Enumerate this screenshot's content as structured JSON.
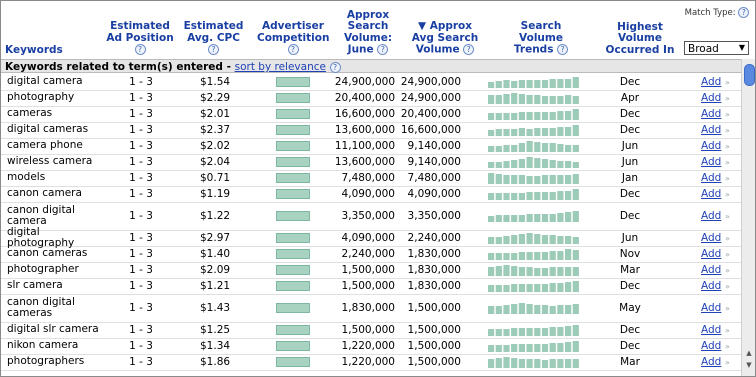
{
  "header": {
    "keywords": "Keywords",
    "est_pos": [
      "Estimated",
      "Ad Position"
    ],
    "est_cpc": [
      "Estimated",
      "Avg. CPC"
    ],
    "competition": [
      "Advertiser",
      "Competition"
    ],
    "june_vol": [
      "Approx",
      "Search",
      "Volume:",
      "June"
    ],
    "avg_vol": [
      "▼ Approx",
      "Avg Search",
      "Volume"
    ],
    "trends": [
      "Search Volume",
      "Trends"
    ],
    "highest": [
      "Highest",
      "Volume",
      "Occurred In"
    ],
    "match_type_label": "Match Type:",
    "match_type_value": "Broad",
    "help_glyph": "?"
  },
  "subheader": {
    "label": "Keywords related to term(s) entered - ",
    "sort_link": "sort by relevance"
  },
  "colors": {
    "header_blue": "#1a3fa3",
    "link": "#1f41b5",
    "bar": "#a8d3c1",
    "trend_bar": "#9ccbb7"
  },
  "rows": [
    {
      "keyword": "digital camera",
      "pos": "1 - 3",
      "cpc": "$1.54",
      "competition": 1.0,
      "june": "24,900,000",
      "avg": "24,900,000",
      "month": "Dec",
      "add": "Add",
      "trend": [
        0.55,
        0.6,
        0.7,
        0.65,
        0.7,
        0.75,
        0.7,
        0.72,
        0.78,
        0.8,
        0.85,
        1.0
      ]
    },
    {
      "keyword": "photography",
      "pos": "1 - 3",
      "cpc": "$2.29",
      "competition": 1.0,
      "june": "20,400,000",
      "avg": "24,900,000",
      "month": "Apr",
      "add": "Add",
      "trend": [
        0.8,
        0.85,
        0.9,
        1.0,
        0.9,
        0.85,
        0.8,
        0.75,
        0.7,
        0.75,
        0.8,
        0.7
      ]
    },
    {
      "keyword": "cameras",
      "pos": "1 - 3",
      "cpc": "$2.01",
      "competition": 1.0,
      "june": "16,600,000",
      "avg": "20,400,000",
      "month": "Dec",
      "add": "Add",
      "trend": [
        0.6,
        0.6,
        0.65,
        0.65,
        0.7,
        0.7,
        0.72,
        0.7,
        0.75,
        0.8,
        0.85,
        1.0
      ]
    },
    {
      "keyword": "digital cameras",
      "pos": "1 - 3",
      "cpc": "$2.37",
      "competition": 1.0,
      "june": "13,600,000",
      "avg": "16,600,000",
      "month": "Dec",
      "add": "Add",
      "trend": [
        0.55,
        0.6,
        0.65,
        0.6,
        0.7,
        0.65,
        0.7,
        0.72,
        0.75,
        0.8,
        0.85,
        1.0
      ]
    },
    {
      "keyword": "camera phone",
      "pos": "1 - 3",
      "cpc": "$2.02",
      "competition": 1.0,
      "june": "11,100,000",
      "avg": "9,140,000",
      "month": "Jun",
      "add": "Add",
      "trend": [
        0.5,
        0.55,
        0.6,
        0.65,
        0.8,
        1.0,
        0.9,
        0.85,
        0.8,
        0.7,
        0.65,
        0.6
      ]
    },
    {
      "keyword": "wireless camera",
      "pos": "1 - 3",
      "cpc": "$2.04",
      "competition": 1.0,
      "june": "13,600,000",
      "avg": "9,140,000",
      "month": "Jun",
      "add": "Add",
      "trend": [
        0.5,
        0.55,
        0.6,
        0.7,
        0.8,
        1.0,
        0.9,
        0.8,
        0.7,
        0.65,
        0.6,
        0.55
      ]
    },
    {
      "keyword": "models",
      "pos": "1 - 3",
      "cpc": "$0.71",
      "competition": 1.0,
      "june": "7,480,000",
      "avg": "7,480,000",
      "month": "Jan",
      "add": "Add",
      "trend": [
        1.0,
        0.9,
        0.85,
        0.8,
        0.8,
        0.75,
        0.75,
        0.8,
        0.8,
        0.85,
        0.85,
        0.9
      ]
    },
    {
      "keyword": "canon camera",
      "pos": "1 - 3",
      "cpc": "$1.19",
      "competition": 1.0,
      "june": "4,090,000",
      "avg": "4,090,000",
      "month": "Dec",
      "add": "Add",
      "trend": [
        0.6,
        0.6,
        0.65,
        0.6,
        0.65,
        0.7,
        0.7,
        0.7,
        0.75,
        0.8,
        0.85,
        1.0
      ]
    },
    {
      "keyword": "canon digital camera",
      "pos": "1 - 3",
      "cpc": "$1.22",
      "competition": 1.0,
      "june": "3,350,000",
      "avg": "3,350,000",
      "month": "Dec",
      "add": "Add",
      "trend": [
        0.55,
        0.6,
        0.6,
        0.65,
        0.65,
        0.7,
        0.7,
        0.72,
        0.75,
        0.8,
        0.88,
        1.0
      ]
    },
    {
      "keyword": "digital photography",
      "pos": "1 - 3",
      "cpc": "$2.97",
      "competition": 1.0,
      "june": "4,090,000",
      "avg": "2,240,000",
      "month": "Jun",
      "add": "Add",
      "trend": [
        0.6,
        0.65,
        0.7,
        0.8,
        0.9,
        1.0,
        0.9,
        0.85,
        0.8,
        0.7,
        0.7,
        0.65
      ]
    },
    {
      "keyword": "canon cameras",
      "pos": "1 - 3",
      "cpc": "$1.40",
      "competition": 1.0,
      "june": "2,240,000",
      "avg": "1,830,000",
      "month": "Nov",
      "add": "Add",
      "trend": [
        0.6,
        0.6,
        0.65,
        0.65,
        0.7,
        0.7,
        0.72,
        0.75,
        0.8,
        0.85,
        1.0,
        0.95
      ]
    },
    {
      "keyword": "photographer",
      "pos": "1 - 3",
      "cpc": "$2.09",
      "competition": 1.0,
      "june": "1,500,000",
      "avg": "1,830,000",
      "month": "Mar",
      "add": "Add",
      "trend": [
        0.85,
        0.9,
        1.0,
        0.9,
        0.85,
        0.8,
        0.75,
        0.75,
        0.8,
        0.8,
        0.85,
        0.8
      ]
    },
    {
      "keyword": "slr camera",
      "pos": "1 - 3",
      "cpc": "$1.21",
      "competition": 1.0,
      "june": "1,500,000",
      "avg": "1,830,000",
      "month": "Dec",
      "add": "Add",
      "trend": [
        0.6,
        0.65,
        0.65,
        0.7,
        0.7,
        0.72,
        0.72,
        0.75,
        0.8,
        0.85,
        0.9,
        1.0
      ]
    },
    {
      "keyword": "canon digital cameras",
      "pos": "1 - 3",
      "cpc": "$1.43",
      "competition": 1.0,
      "june": "1,830,000",
      "avg": "1,500,000",
      "month": "May",
      "add": "Add",
      "trend": [
        0.7,
        0.75,
        0.8,
        0.9,
        1.0,
        0.9,
        0.85,
        0.8,
        0.75,
        0.8,
        0.85,
        0.9
      ]
    },
    {
      "keyword": "digital slr camera",
      "pos": "1 - 3",
      "cpc": "$1.25",
      "competition": 1.0,
      "june": "1,500,000",
      "avg": "1,500,000",
      "month": "Dec",
      "add": "Add",
      "trend": [
        0.6,
        0.6,
        0.65,
        0.7,
        0.7,
        0.75,
        0.72,
        0.75,
        0.8,
        0.85,
        0.9,
        1.0
      ]
    },
    {
      "keyword": "nikon camera",
      "pos": "1 - 3",
      "cpc": "$1.34",
      "competition": 1.0,
      "june": "1,220,000",
      "avg": "1,500,000",
      "month": "Dec",
      "add": "Add",
      "trend": [
        0.6,
        0.65,
        0.65,
        0.7,
        0.7,
        0.7,
        0.72,
        0.75,
        0.8,
        0.85,
        0.9,
        1.0
      ]
    },
    {
      "keyword": "photographers",
      "pos": "1 - 3",
      "cpc": "$1.86",
      "competition": 1.0,
      "june": "1,220,000",
      "avg": "1,500,000",
      "month": "Mar",
      "add": "Add",
      "trend": [
        0.85,
        0.9,
        1.0,
        0.9,
        0.85,
        0.8,
        0.78,
        0.75,
        0.8,
        0.82,
        0.85,
        0.8
      ]
    }
  ]
}
